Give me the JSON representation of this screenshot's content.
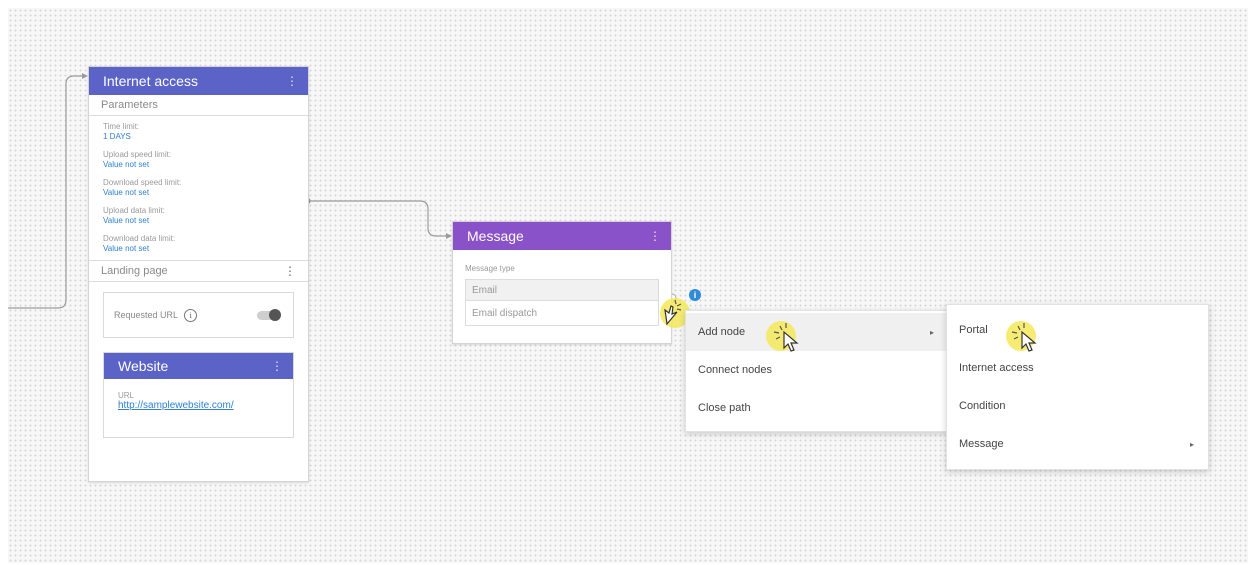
{
  "internet_access_node": {
    "title": "Internet access",
    "kebab": "⋮",
    "parameters_label": "Parameters",
    "parameters": [
      {
        "label": "Time limit:",
        "value": "1 DAYS"
      },
      {
        "label": "Upload speed limit:",
        "value": "Value not set"
      },
      {
        "label": "Download speed limit:",
        "value": "Value not set"
      },
      {
        "label": "Upload data limit:",
        "value": "Value not set"
      },
      {
        "label": "Download data limit:",
        "value": "Value not set"
      }
    ],
    "landing_page_label": "Landing page",
    "requested_url_label": "Requested URL",
    "requested_url_toggle": "off",
    "website": {
      "title": "Website",
      "url_label": "URL",
      "url": "http://samplewebsite.com/"
    }
  },
  "message_node": {
    "title": "Message",
    "kebab": "⋮",
    "message_type_label": "Message type",
    "message_type_value": "Email",
    "dispatch_value": "Email dispatch"
  },
  "context_menu": {
    "items": [
      {
        "label": "Add node",
        "has_submenu": true,
        "active": true
      },
      {
        "label": "Connect nodes",
        "has_submenu": false
      },
      {
        "label": "Close path",
        "has_submenu": false
      }
    ]
  },
  "submenu": {
    "items": [
      {
        "label": "Portal",
        "has_submenu": false
      },
      {
        "label": "Internet access",
        "has_submenu": false
      },
      {
        "label": "Condition",
        "has_submenu": false
      },
      {
        "label": "Message",
        "has_submenu": true
      }
    ]
  },
  "colors": {
    "internet_access_header": "#5b63c6",
    "message_header": "#8a52c9",
    "website_header": "#c6d843",
    "link": "#2f7fd0",
    "click_highlight": "#f5e85a"
  },
  "icons": [
    "kebab-menu-icon",
    "info-icon",
    "toggle-switch",
    "submenu-caret-icon",
    "cursor-click-icon",
    "notification-badge-icon"
  ]
}
